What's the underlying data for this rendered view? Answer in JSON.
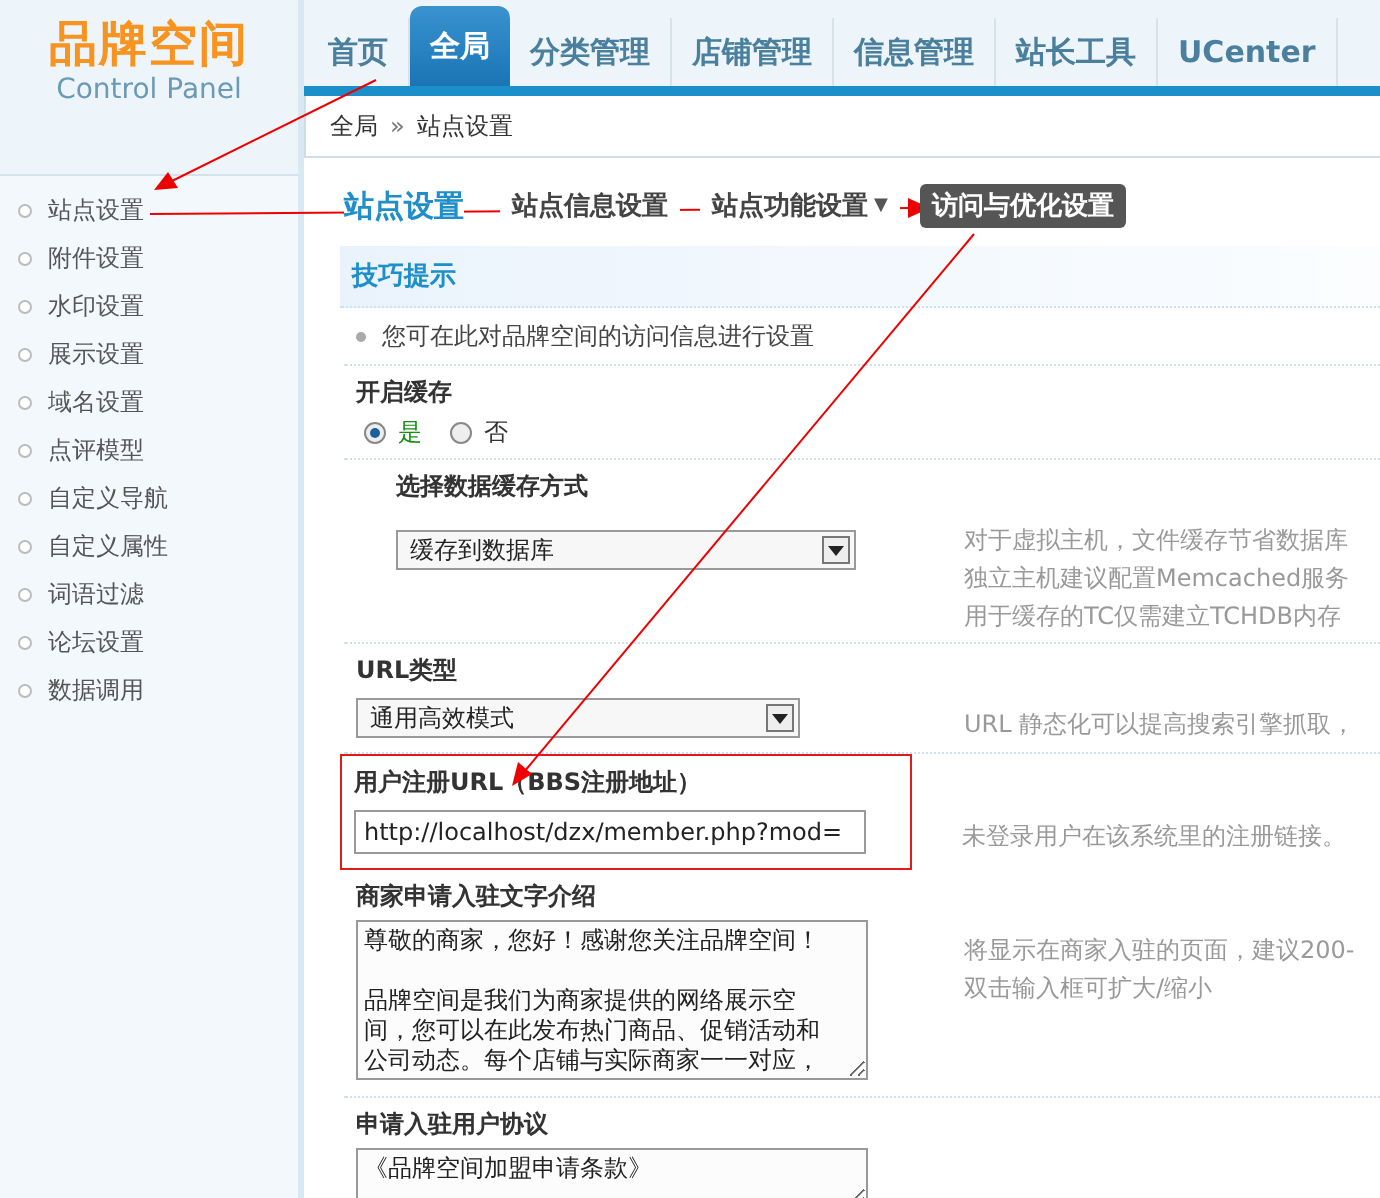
{
  "logo": {
    "title": "品牌空间",
    "subtitle": "Control Panel"
  },
  "nav_tabs": [
    {
      "label": "首页",
      "selected": false
    },
    {
      "label": "全局",
      "selected": true
    },
    {
      "label": "分类管理",
      "selected": false
    },
    {
      "label": "店铺管理",
      "selected": false
    },
    {
      "label": "信息管理",
      "selected": false
    },
    {
      "label": "站长工具",
      "selected": false
    },
    {
      "label": "UCenter",
      "selected": false
    }
  ],
  "breadcrumb": {
    "items": [
      "全局",
      "站点设置"
    ],
    "separator": "»"
  },
  "sidebar": {
    "items": [
      "站点设置",
      "附件设置",
      "水印设置",
      "展示设置",
      "域名设置",
      "点评模型",
      "自定义导航",
      "自定义属性",
      "词语过滤",
      "论坛设置",
      "数据调用"
    ]
  },
  "subnav": {
    "title": "站点设置",
    "tabs": [
      {
        "label": "站点信息设置",
        "selected": false
      },
      {
        "label": "站点功能设置",
        "selected": false,
        "menu_caret": "▼"
      },
      {
        "label": "访问与优化设置",
        "selected": true
      }
    ]
  },
  "tips": {
    "title": "技巧提示",
    "items": [
      "您可在此对品牌空间的访问信息进行设置"
    ]
  },
  "settings": [
    {
      "kind": "radio",
      "label": "开启缓存",
      "options": [
        {
          "label": "是",
          "selected": true
        },
        {
          "label": "否",
          "selected": false
        }
      ]
    },
    {
      "kind": "select",
      "label": "选择数据缓存方式",
      "indented": true,
      "value": "缓存到数据库",
      "help": [
        "对于虚拟主机，文件缓存节省数据库",
        "独立主机建议配置Memcached服务",
        "用于缓存的TC仅需建立TCHDB内存"
      ]
    },
    {
      "kind": "select",
      "label": "URL类型",
      "indented": false,
      "value": "通用高效模式",
      "help": [
        "URL 静态化可以提高搜索引擎抓取，"
      ]
    },
    {
      "kind": "text",
      "label": "用户注册URL（BBS注册地址）",
      "highlighted": true,
      "value": "http://localhost/dzx/member.php?mod=",
      "help": [
        "未登录用户在该系统里的注册链接。"
      ]
    },
    {
      "kind": "textarea",
      "label": "商家申请入驻文字介绍",
      "paragraphs": [
        "尊敬的商家，您好！感谢您关注品牌空间！",
        "品牌空间是我们为商家提供的网络展示空间，您可以在此发布热门商品、促销活动和公司动态。每个店铺与实际商家一一对应，"
      ],
      "help": [
        "将显示在商家入驻的页面，建议200-",
        "双击输入框可扩大/缩小"
      ]
    },
    {
      "kind": "textarea",
      "label": "申请入驻用户协议",
      "value": "《品牌空间加盟申请条款》"
    }
  ]
}
